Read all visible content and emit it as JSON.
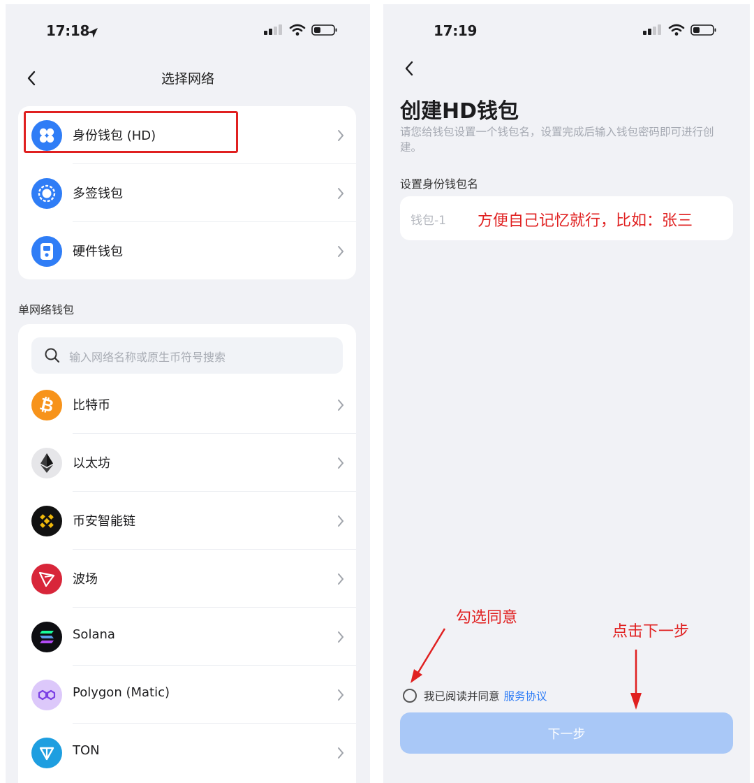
{
  "left": {
    "status": {
      "time": "17:18"
    },
    "nav": {
      "title": "选择网络"
    },
    "wallet_types": [
      {
        "label": "身份钱包 (HD)",
        "icon": "clover-icon",
        "color": "#2f7df6"
      },
      {
        "label": "多签钱包",
        "icon": "ring-icon",
        "color": "#2f7df6"
      },
      {
        "label": "硬件钱包",
        "icon": "hardware-wallet-icon",
        "color": "#2f7df6"
      }
    ],
    "section_label": "单网络钱包",
    "search": {
      "placeholder": "输入网络名称或原生币符号搜索"
    },
    "networks": [
      {
        "label": "比特币",
        "icon": "bitcoin-icon",
        "color": "#f7931a"
      },
      {
        "label": "以太坊",
        "icon": "ethereum-icon",
        "color": "#e6e6e9"
      },
      {
        "label": "币安智能链",
        "icon": "bnb-icon",
        "color": "#111111"
      },
      {
        "label": "波场",
        "icon": "tron-icon",
        "color": "#d8263a"
      },
      {
        "label": "Solana",
        "icon": "solana-icon",
        "color": "#0e0e12"
      },
      {
        "label": "Polygon (Matic)",
        "icon": "polygon-icon",
        "color": "#dcc8fa"
      },
      {
        "label": "TON",
        "icon": "ton-icon",
        "color": "#1e9ee0"
      }
    ]
  },
  "right": {
    "status": {
      "time": "17:19"
    },
    "title": "创建HD钱包",
    "description": "请您给钱包设置一个钱包名，设置完成后输入钱包密码即可进行创建。",
    "field_label": "设置身份钱包名",
    "name_input": {
      "placeholder": "钱包-1"
    },
    "agreement": {
      "text": "我已阅读并同意",
      "link": "服务协议"
    },
    "next_button": "下一步"
  },
  "annotations": {
    "hint_name": "方便自己记忆就行，比如：张三",
    "hint_agree": "勾选同意",
    "hint_next": "点击下一步"
  },
  "colors": {
    "accent": "#2f7df6",
    "annotation": "#e02020",
    "button_disabled": "#a9c8f7"
  }
}
